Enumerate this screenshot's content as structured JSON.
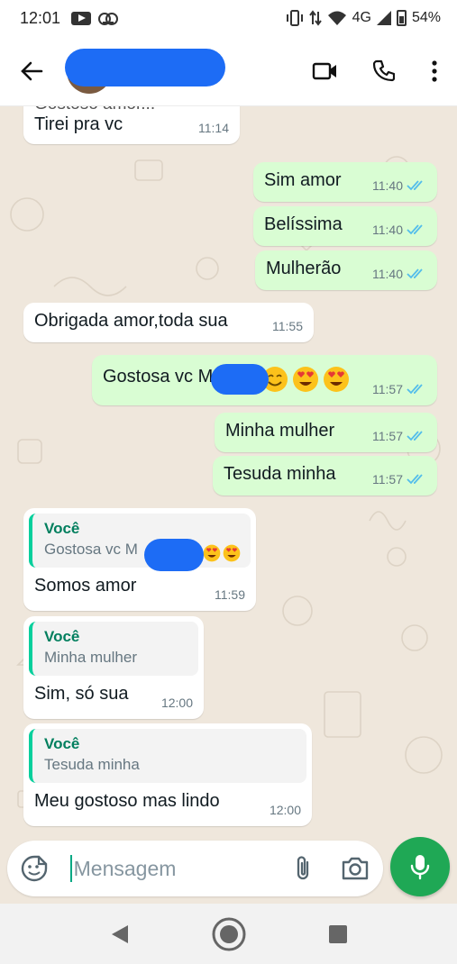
{
  "status_bar": {
    "time": "12:01",
    "network": "4G",
    "battery": "54%"
  },
  "header": {
    "contact_name": "",
    "icons": [
      "back-arrow-icon",
      "video-call-icon",
      "phone-icon",
      "more-vertical-icon"
    ]
  },
  "messages": [
    {
      "type": "in",
      "partial_text": "Gostoso amor...",
      "text": "Tirei pra vc",
      "time": "11:14"
    },
    {
      "type": "out",
      "text": "Sim amor",
      "time": "11:40",
      "status": "read"
    },
    {
      "type": "out",
      "text": "Belíssima",
      "time": "11:40",
      "status": "read"
    },
    {
      "type": "out",
      "text": "Mulherão",
      "time": "11:40",
      "status": "read"
    },
    {
      "type": "in",
      "text": "Obrigada amor,toda sua",
      "time": "11:55"
    },
    {
      "type": "out",
      "text": "Gostosa vc M",
      "time": "11:57",
      "status": "read",
      "emojis": [
        "smile",
        "heart-eyes",
        "heart-eyes"
      ]
    },
    {
      "type": "out",
      "text": "Minha mulher",
      "time": "11:57",
      "status": "read"
    },
    {
      "type": "out",
      "text": "Tesuda minha",
      "time": "11:57",
      "status": "read"
    },
    {
      "type": "in",
      "quote": {
        "author": "Você",
        "text": "Gostosa vc M"
      },
      "text": "Somos amor",
      "time": "11:59"
    },
    {
      "type": "in",
      "quote": {
        "author": "Você",
        "text": "Minha mulher"
      },
      "text": "Sim, só sua",
      "time": "12:00"
    },
    {
      "type": "in",
      "quote": {
        "author": "Você",
        "text": "Tesuda minha"
      },
      "text": "Meu gostoso mas lindo",
      "time": "12:00"
    }
  ],
  "composer": {
    "placeholder": "Mensagem",
    "icons": [
      "sticker-icon",
      "attach-icon",
      "camera-icon",
      "mic-icon"
    ]
  },
  "colors": {
    "outgoing_bubble": "#d9fdd3",
    "incoming_bubble": "#ffffff",
    "read_ticks": "#53bdeb",
    "accent_green": "#1fa855",
    "quote_author": "#027f5e",
    "wallpaper": "#efe7dc"
  }
}
